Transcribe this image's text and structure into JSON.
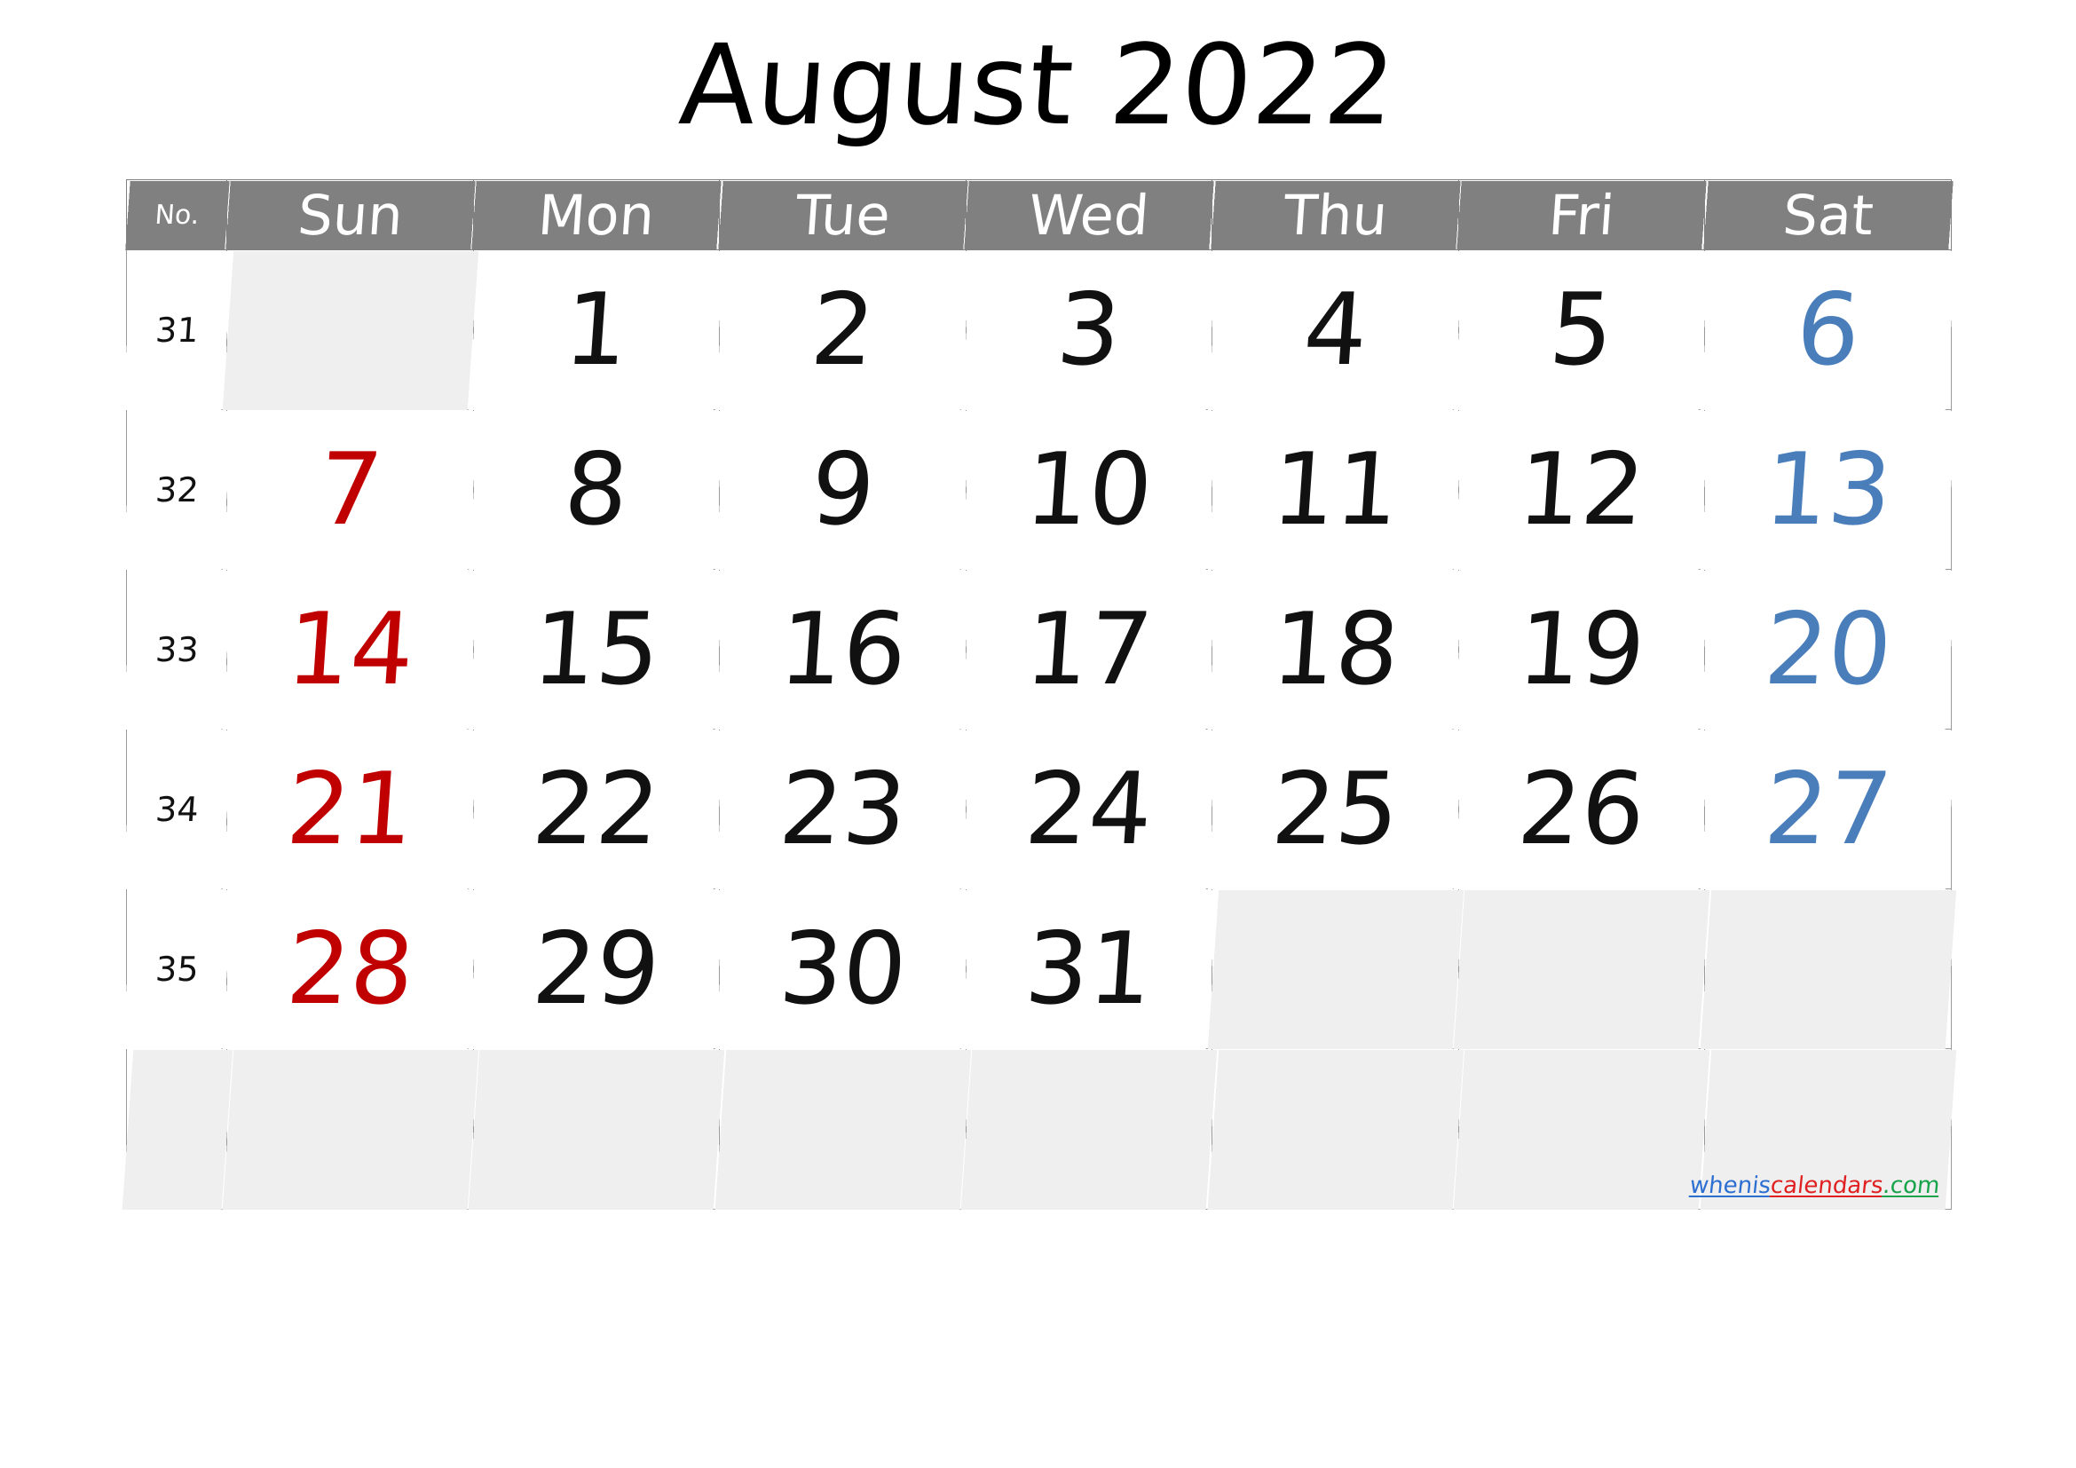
{
  "title": "August 2022",
  "header": {
    "week_label": "No.",
    "days": [
      "Sun",
      "Mon",
      "Tue",
      "Wed",
      "Thu",
      "Fri",
      "Sat"
    ]
  },
  "colors": {
    "header_background": "#808080",
    "header_text": "#ffffff",
    "weekday_text": "#111111",
    "sunday_text": "#c00000",
    "saturday_text": "#4a7ebb",
    "empty_cell_background": "#efefef",
    "grid_line": "#9a9a9a",
    "page_background": "#ffffff"
  },
  "weeks": [
    {
      "number": "31",
      "days": [
        {
          "value": "",
          "kind": "empty",
          "col": "sun"
        },
        {
          "value": "1",
          "kind": "weekday",
          "col": "mon"
        },
        {
          "value": "2",
          "kind": "weekday",
          "col": "tue"
        },
        {
          "value": "3",
          "kind": "weekday",
          "col": "wed"
        },
        {
          "value": "4",
          "kind": "weekday",
          "col": "thu"
        },
        {
          "value": "5",
          "kind": "weekday",
          "col": "fri"
        },
        {
          "value": "6",
          "kind": "saturday",
          "col": "sat"
        }
      ]
    },
    {
      "number": "32",
      "days": [
        {
          "value": "7",
          "kind": "sunday",
          "col": "sun"
        },
        {
          "value": "8",
          "kind": "weekday",
          "col": "mon"
        },
        {
          "value": "9",
          "kind": "weekday",
          "col": "tue"
        },
        {
          "value": "10",
          "kind": "weekday",
          "col": "wed"
        },
        {
          "value": "11",
          "kind": "weekday",
          "col": "thu"
        },
        {
          "value": "12",
          "kind": "weekday",
          "col": "fri"
        },
        {
          "value": "13",
          "kind": "saturday",
          "col": "sat"
        }
      ]
    },
    {
      "number": "33",
      "days": [
        {
          "value": "14",
          "kind": "sunday",
          "col": "sun"
        },
        {
          "value": "15",
          "kind": "weekday",
          "col": "mon"
        },
        {
          "value": "16",
          "kind": "weekday",
          "col": "tue"
        },
        {
          "value": "17",
          "kind": "weekday",
          "col": "wed"
        },
        {
          "value": "18",
          "kind": "weekday",
          "col": "thu"
        },
        {
          "value": "19",
          "kind": "weekday",
          "col": "fri"
        },
        {
          "value": "20",
          "kind": "saturday",
          "col": "sat"
        }
      ]
    },
    {
      "number": "34",
      "days": [
        {
          "value": "21",
          "kind": "sunday",
          "col": "sun"
        },
        {
          "value": "22",
          "kind": "weekday",
          "col": "mon"
        },
        {
          "value": "23",
          "kind": "weekday",
          "col": "tue"
        },
        {
          "value": "24",
          "kind": "weekday",
          "col": "wed"
        },
        {
          "value": "25",
          "kind": "weekday",
          "col": "thu"
        },
        {
          "value": "26",
          "kind": "weekday",
          "col": "fri"
        },
        {
          "value": "27",
          "kind": "saturday",
          "col": "sat"
        }
      ]
    },
    {
      "number": "35",
      "days": [
        {
          "value": "28",
          "kind": "sunday",
          "col": "sun"
        },
        {
          "value": "29",
          "kind": "weekday",
          "col": "mon"
        },
        {
          "value": "30",
          "kind": "weekday",
          "col": "tue"
        },
        {
          "value": "31",
          "kind": "weekday",
          "col": "wed"
        },
        {
          "value": "",
          "kind": "empty",
          "col": "thu"
        },
        {
          "value": "",
          "kind": "empty",
          "col": "fri"
        },
        {
          "value": "",
          "kind": "empty",
          "col": "sat"
        }
      ]
    },
    {
      "number": "",
      "filler": true,
      "days": [
        {
          "value": "",
          "kind": "empty",
          "col": "sun"
        },
        {
          "value": "",
          "kind": "empty",
          "col": "mon"
        },
        {
          "value": "",
          "kind": "empty",
          "col": "tue"
        },
        {
          "value": "",
          "kind": "empty",
          "col": "wed"
        },
        {
          "value": "",
          "kind": "empty",
          "col": "thu"
        },
        {
          "value": "",
          "kind": "empty",
          "col": "fri"
        },
        {
          "value": "",
          "kind": "empty",
          "col": "sat"
        }
      ]
    }
  ],
  "watermark": {
    "part1": "whenis",
    "part2": "calendars",
    "part3": ".com"
  }
}
